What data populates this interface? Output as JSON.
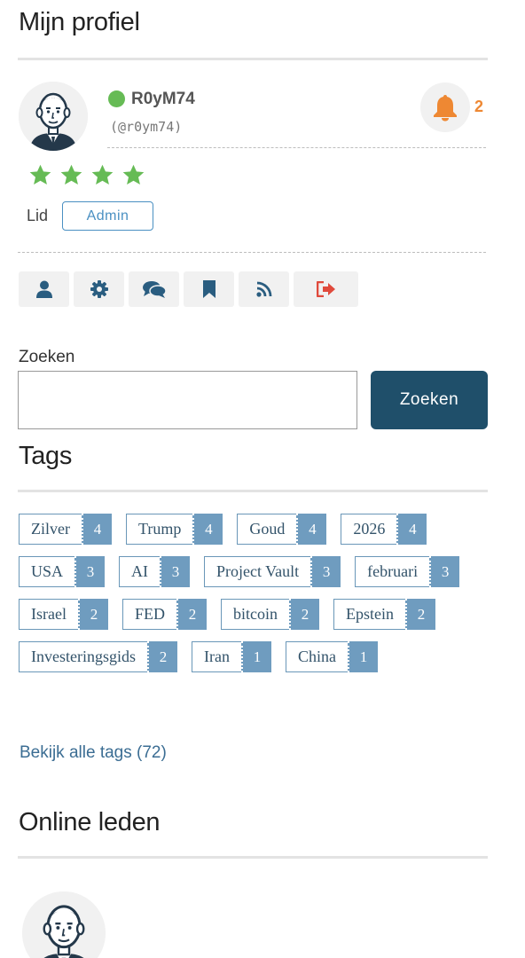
{
  "profile": {
    "title": "Mijn profiel",
    "username": "R0yM74",
    "handle": "(@r0ym74)",
    "status": "online",
    "notifications": "2",
    "rating_stars": 4,
    "role_label": "Lid",
    "role_badge": "Admin",
    "actions": [
      {
        "name": "profile-action-user",
        "icon": "user-icon"
      },
      {
        "name": "profile-action-settings",
        "icon": "gear-icon"
      },
      {
        "name": "profile-action-messages",
        "icon": "comments-icon"
      },
      {
        "name": "profile-action-bookmarks",
        "icon": "bookmark-icon"
      },
      {
        "name": "profile-action-feed",
        "icon": "rss-icon"
      },
      {
        "name": "profile-action-logout",
        "icon": "sign-out-icon"
      }
    ]
  },
  "search": {
    "label": "Zoeken",
    "value": "",
    "placeholder": "",
    "button_label": "Zoeken"
  },
  "tags": {
    "title": "Tags",
    "items": [
      {
        "name": "Zilver",
        "count": "4"
      },
      {
        "name": "Trump",
        "count": "4"
      },
      {
        "name": "Goud",
        "count": "4"
      },
      {
        "name": "2026",
        "count": "4"
      },
      {
        "name": "USA",
        "count": "3"
      },
      {
        "name": "AI",
        "count": "3"
      },
      {
        "name": "Project Vault",
        "count": "3"
      },
      {
        "name": "februari",
        "count": "3"
      },
      {
        "name": "Israel",
        "count": "2"
      },
      {
        "name": "FED",
        "count": "2"
      },
      {
        "name": "bitcoin",
        "count": "2"
      },
      {
        "name": "Epstein",
        "count": "2"
      },
      {
        "name": "Investeringsgids",
        "count": "2"
      },
      {
        "name": "Iran",
        "count": "1"
      },
      {
        "name": "China",
        "count": "1"
      }
    ],
    "view_all": "Bekijk alle tags (72)"
  },
  "online": {
    "title": "Online leden"
  },
  "colors": {
    "online": "#66bb55",
    "bell": "#ee8833",
    "star": "#66bb55",
    "accent": "#1f4f6a",
    "tag_count_bg": "#6f9cbf",
    "logout": "#e04a3c",
    "icon": "#2a5d80"
  }
}
